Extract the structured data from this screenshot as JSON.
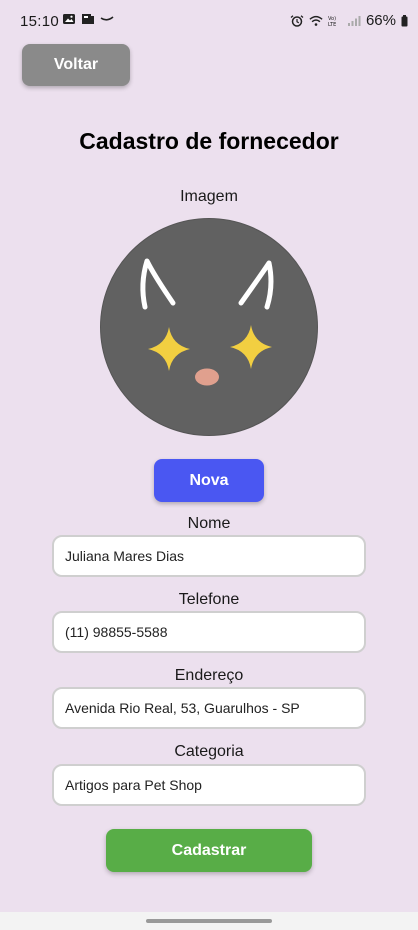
{
  "status_bar": {
    "time": "15:10",
    "battery": "66%",
    "left_icons": [
      "image-icon",
      "notification-icon",
      "cast-icon"
    ],
    "right_icons": [
      "alarm-icon",
      "wifi-icon",
      "volte-icon",
      "signal-icon",
      "battery-icon"
    ]
  },
  "header": {
    "back_label": "Voltar",
    "title": "Cadastro de fornecedor"
  },
  "image_section": {
    "label": "Imagem",
    "new_label": "Nova",
    "colors": {
      "avatar_bg": "#616161",
      "sparkle": "#f2cf41",
      "nose": "#e0a08e",
      "ears": "#ffffff"
    }
  },
  "form": {
    "name": {
      "label": "Nome",
      "value": "Juliana Mares Dias"
    },
    "phone": {
      "label": "Telefone",
      "value": "(11) 98855-5588"
    },
    "address": {
      "label": "Endereço",
      "value": "Avenida Rio Real, 53, Guarulhos - SP"
    },
    "category": {
      "label": "Categoria",
      "value": "Artigos para Pet Shop"
    },
    "submit_label": "Cadastrar"
  },
  "colors": {
    "background": "#ece0ee",
    "back_button": "#8a8a8a",
    "new_button": "#4a57f2",
    "submit_button": "#58ad47"
  }
}
